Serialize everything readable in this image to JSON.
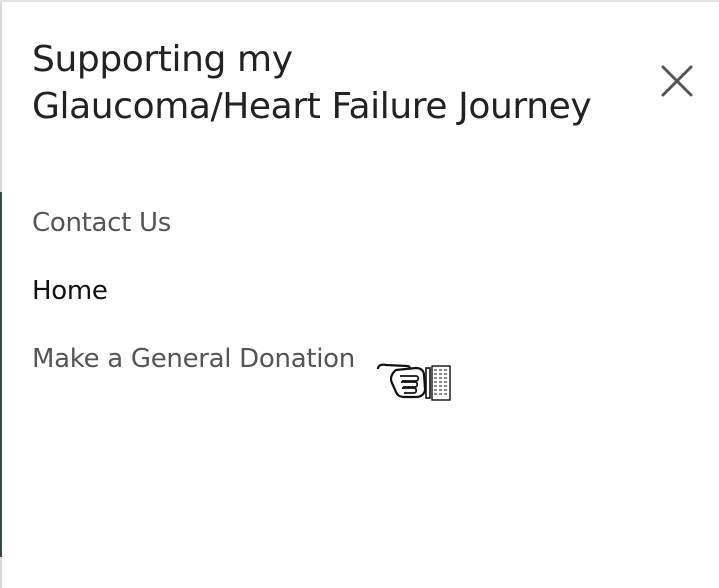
{
  "header": {
    "title": "Supporting my Glaucoma/Heart Failure Journey"
  },
  "nav": {
    "items": [
      {
        "label": "Contact Us",
        "active": false
      },
      {
        "label": "Home",
        "active": true
      },
      {
        "label": "Make a General Donation",
        "active": false
      }
    ]
  },
  "icons": {
    "close": "close-icon",
    "cursor": "pointing-hand-cursor-icon"
  },
  "colors": {
    "title": "#222222",
    "nav_text": "#555555",
    "nav_active": "#111111",
    "close_icon": "#555555",
    "background": "#ffffff"
  }
}
